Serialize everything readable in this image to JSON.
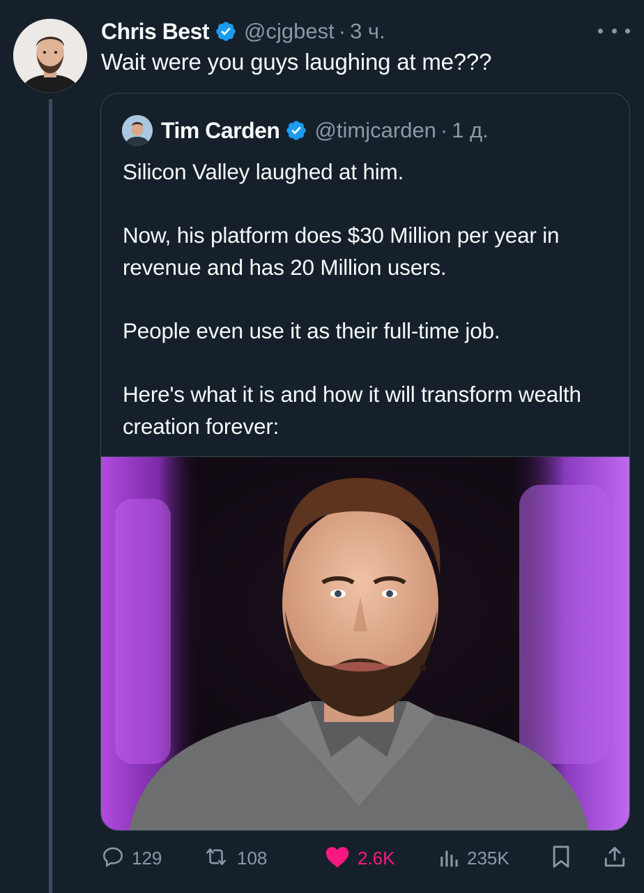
{
  "tweet": {
    "author_name": "Chris Best",
    "handle": "@cjgbest",
    "separator": "·",
    "time": "3 ч.",
    "text": "Wait were you guys laughing at me???"
  },
  "quoted_tweet": {
    "author_name": "Tim Carden",
    "handle": "@timjcarden",
    "separator": "·",
    "time": "1 д.",
    "paragraphs": [
      "Silicon Valley laughed at him.",
      "Now, his platform does $30 Million per year in revenue and has 20 Million users.",
      "People even use it as their full-time job.",
      "Here's what it is and how it will transform wealth creation forever:"
    ]
  },
  "actions": {
    "replies": "129",
    "reposts": "108",
    "likes": "2.6K",
    "views": "235K"
  },
  "colors": {
    "background": "#15202b",
    "text_primary": "#f7f9f9",
    "text_secondary": "#8b98a5",
    "verified": "#1d9bf0",
    "like": "#f91880",
    "border": "#38444d"
  },
  "icons": [
    "verified-badge-icon",
    "more-icon",
    "reply-icon",
    "repost-icon",
    "like-icon",
    "views-icon",
    "bookmark-icon",
    "share-icon"
  ]
}
